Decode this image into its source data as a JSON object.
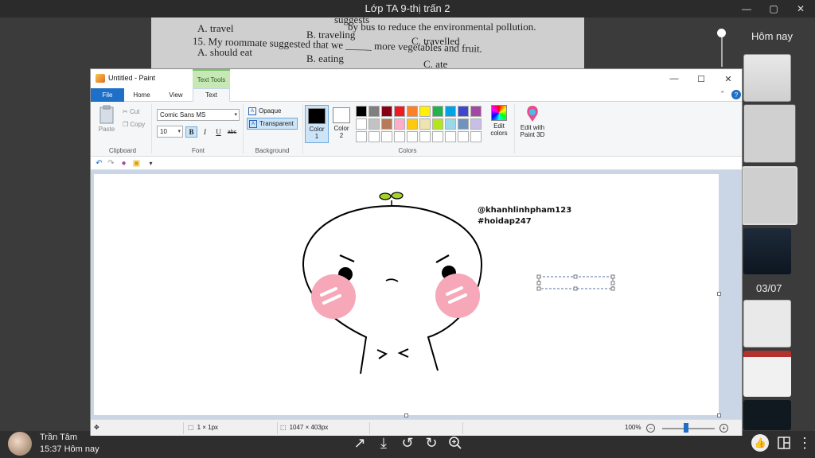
{
  "viewer": {
    "title": "Lớp TA 9-thị trấn 2",
    "today_label": "Hôm nay",
    "date_label": "03/07",
    "user_name": "Trần Tâm",
    "user_time": "15:37 Hôm nay"
  },
  "photo": {
    "line1_a": "A. travel",
    "line1_b": "B. traveling",
    "line1_c": "C. travelled",
    "line0": "by bus to reduce the environmental pollution.",
    "line2": "15. My roommate suggested that we _____ more vegetables and fruit.",
    "line3_a": "A. should eat",
    "line3_b": "B. eating",
    "line3_c": "C. ate",
    "line_top": "suggests"
  },
  "paint": {
    "title": "Untitled - Paint",
    "context_tab": "Text Tools",
    "tabs": [
      "File",
      "Home",
      "View",
      "Text"
    ],
    "clipboard": {
      "paste": "Paste",
      "cut": "Cut",
      "copy": "Copy",
      "label": "Clipboard"
    },
    "font": {
      "family": "Comic Sans MS",
      "size": "10",
      "bold": "B",
      "italic": "I",
      "underline": "U",
      "strike": "abc",
      "label": "Font"
    },
    "background": {
      "opaque": "Opaque",
      "transparent": "Transparent",
      "label": "Background"
    },
    "colors": {
      "color1": "Color 1",
      "color1_a": "Color",
      "color1_b": "1",
      "color2_a": "Color",
      "color2_b": "2",
      "label": "Colors",
      "edit_colors_a": "Edit",
      "edit_colors_b": "colors",
      "paint3d_a": "Edit with",
      "paint3d_b": "Paint 3D",
      "primary": "#000000",
      "secondary": "#ffffff",
      "palette_row1": [
        "#000000",
        "#7f7f7f",
        "#880015",
        "#ed1c24",
        "#ff7f27",
        "#fff200",
        "#22b14c",
        "#00a2e8",
        "#3f48cc",
        "#a349a4"
      ],
      "palette_row2": [
        "#ffffff",
        "#c3c3c3",
        "#b97a57",
        "#ffaec9",
        "#ffc90e",
        "#efe4b0",
        "#b5e61d",
        "#99d9ea",
        "#7092be",
        "#c8bfe7"
      ]
    },
    "canvas_text": {
      "handle": "@khanhlinhpham123",
      "tag": "#hoidap247"
    },
    "status": {
      "selection": "1 × 1px",
      "size": "1047 × 403px",
      "zoom": "100%"
    }
  }
}
